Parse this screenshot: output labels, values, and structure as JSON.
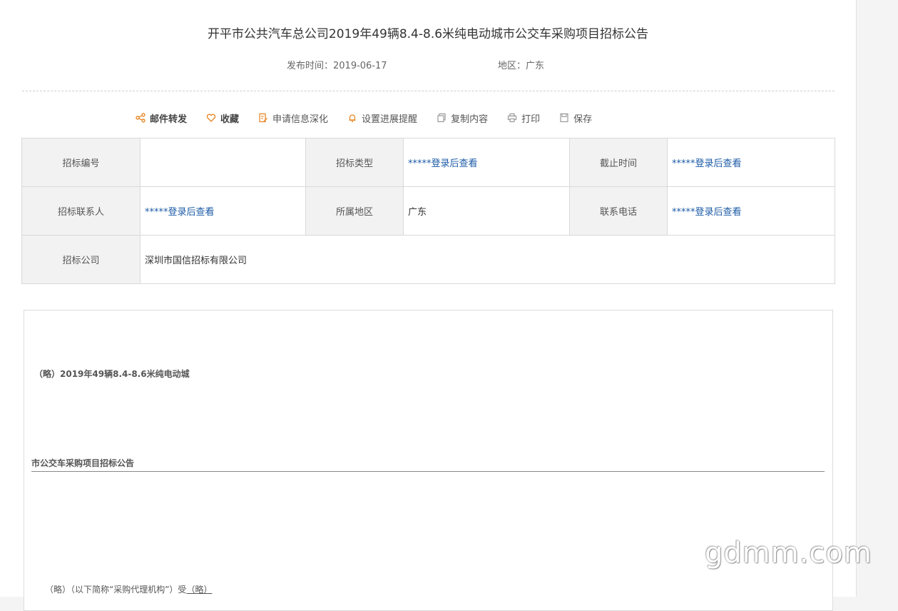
{
  "title": "开平市公共汽车总公司2019年49辆8.4-8.6米纯电动城市公交车采购项目招标公告",
  "meta": {
    "date": "发布时间：2019-06-17",
    "region": "地区：广东"
  },
  "toolbar": {
    "email": "邮件转发",
    "favorite": "收藏",
    "apply": "申请信息深化",
    "remind": "设置进展提醒",
    "copy": "复制内容",
    "print": "打印",
    "save": "保存"
  },
  "table": {
    "row1": {
      "l1": "招标编号",
      "v1": "",
      "l2": "招标类型",
      "v2": "*****登录后查看",
      "l3": "截止时间",
      "v3": "*****登录后查看"
    },
    "row2": {
      "l1": "招标联系人",
      "v1": "*****登录后查看",
      "l2": "所属地区",
      "v2": "广东",
      "l3": "联系电话",
      "v3": "*****登录后查看"
    },
    "row3": {
      "l1": "招标公司",
      "v1": "深圳市国信招标有限公司"
    }
  },
  "content": {
    "line1": "（略）2019年49辆8.4-8.6米纯电动城",
    "line2": "市公交车采购项目招标公告",
    "line3_prefix": "（略）（以下简称“采购代理机构”）受",
    "line3_underlined": "（略）"
  },
  "watermark": "gdmm.com",
  "colors": {
    "accent_orange": "#e8882a",
    "link_blue": "#1b5aa6"
  }
}
